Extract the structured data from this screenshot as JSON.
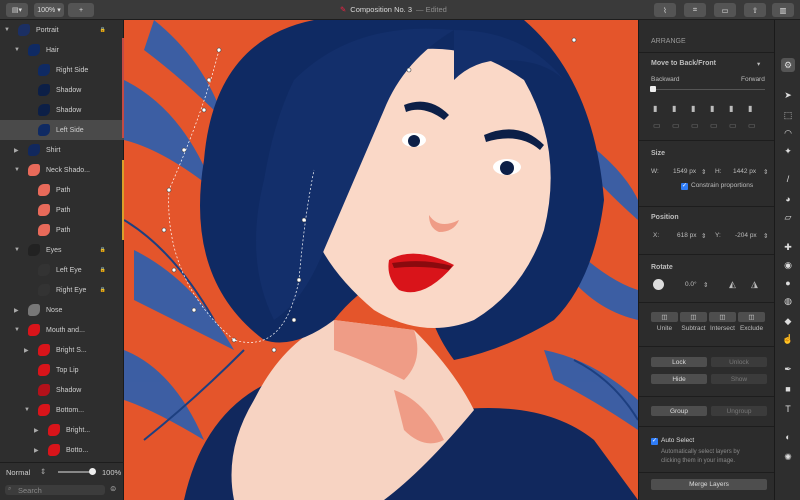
{
  "toolbar": {
    "zoom": "100%",
    "add": "+",
    "title": "Composition No. 3",
    "status": "— Edited"
  },
  "layers": [
    {
      "name": "Portrait",
      "indent": 0,
      "expanded": true,
      "lock": true
    },
    {
      "name": "Hair",
      "indent": 1,
      "expanded": true
    },
    {
      "name": "Right Side",
      "indent": 2
    },
    {
      "name": "Shadow",
      "indent": 2
    },
    {
      "name": "Shadow",
      "indent": 2
    },
    {
      "name": "Left Side",
      "indent": 2,
      "selected": true
    },
    {
      "name": "Shirt",
      "indent": 1
    },
    {
      "name": "Neck Shado...",
      "indent": 1,
      "expanded": true
    },
    {
      "name": "Path",
      "indent": 2
    },
    {
      "name": "Path",
      "indent": 2
    },
    {
      "name": "Path",
      "indent": 2
    },
    {
      "name": "Eyes",
      "indent": 1,
      "expanded": true,
      "lock": true
    },
    {
      "name": "Left Eye",
      "indent": 2,
      "lock": true
    },
    {
      "name": "Right Eye",
      "indent": 2,
      "lock": true
    },
    {
      "name": "Nose",
      "indent": 1
    },
    {
      "name": "Mouth and...",
      "indent": 1,
      "expanded": true
    },
    {
      "name": "Bright S...",
      "indent": 2
    },
    {
      "name": "Top Lip",
      "indent": 2
    },
    {
      "name": "Shadow",
      "indent": 2
    },
    {
      "name": "Bottom...",
      "indent": 2,
      "expanded": true
    },
    {
      "name": "Bright...",
      "indent": 3
    },
    {
      "name": "Botto...",
      "indent": 3
    }
  ],
  "layers_footer": {
    "blend_mode": "Normal",
    "opacity": "100%",
    "search_placeholder": "Search"
  },
  "arrange": {
    "header": "ARRANGE",
    "move_label": "Move to Back/Front",
    "backward": "Backward",
    "forward": "Forward"
  },
  "size": {
    "header": "Size",
    "w_label": "W:",
    "w": "1549 px",
    "h_label": "H:",
    "h": "1442 px",
    "constrain": "Constrain proportions"
  },
  "position": {
    "header": "Position",
    "x_label": "X:",
    "x": "618 px",
    "y_label": "Y:",
    "y": "-204 px"
  },
  "rotate": {
    "header": "Rotate",
    "angle": "0.0°"
  },
  "boolean_ops": [
    "Unite",
    "Subtract",
    "Intersect",
    "Exclude"
  ],
  "buttons": {
    "lock": "Lock",
    "unlock": "Unlock",
    "hide": "Hide",
    "show": "Show",
    "group": "Group",
    "ungroup": "Ungroup",
    "merge": "Merge Layers"
  },
  "auto_select": {
    "label": "Auto Select",
    "desc1": "Automatically select layers by",
    "desc2": "clicking them in your image."
  },
  "colors": {
    "canvas_bg": "#e8542a",
    "hair": "#0f2a63",
    "skin": "#f9d6c4",
    "lips": "#d9141a",
    "accent_blue": "#2a5fb0"
  }
}
